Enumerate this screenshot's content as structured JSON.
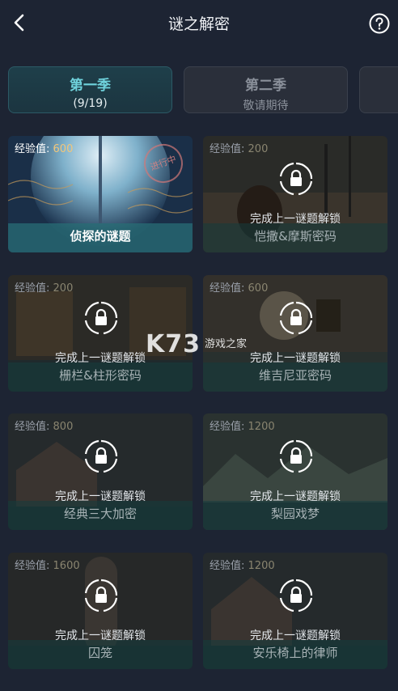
{
  "header": {
    "title": "谜之解密",
    "back_icon": "back-arrow-icon",
    "help_icon": "question-circle-icon"
  },
  "seasons": [
    {
      "name": "第一季",
      "sub": "(9/19)",
      "active": true
    },
    {
      "name": "第二季",
      "sub": "敬请期待",
      "active": false
    }
  ],
  "lock_hint": "完成上一谜题解锁",
  "cards": [
    {
      "xp_label": "经验值:",
      "xp_value": "600",
      "name": "侦探的谜题",
      "stamp": "进行中"
    },
    {
      "xp_label": "经验值:",
      "xp_value": "200",
      "name": "恺撒&摩斯密码"
    },
    {
      "xp_label": "经验值:",
      "xp_value": "200",
      "name": "栅栏&柱形密码"
    },
    {
      "xp_label": "经验值:",
      "xp_value": "600",
      "name": "维吉尼亚密码"
    },
    {
      "xp_label": "经验值:",
      "xp_value": "800",
      "name": "经典三大加密"
    },
    {
      "xp_label": "经验值:",
      "xp_value": "1200",
      "name": "梨园戏梦"
    },
    {
      "xp_label": "经验值:",
      "xp_value": "1600",
      "name": "囚笼"
    },
    {
      "xp_label": "经验值:",
      "xp_value": "1200",
      "name": "安乐椅上的律师"
    }
  ],
  "watermark": {
    "main": "K73",
    "sub": "游戏之家"
  },
  "colors": {
    "background": "#1d2433",
    "accent": "#6fd2dc",
    "xp_value": "#f2c67a"
  }
}
